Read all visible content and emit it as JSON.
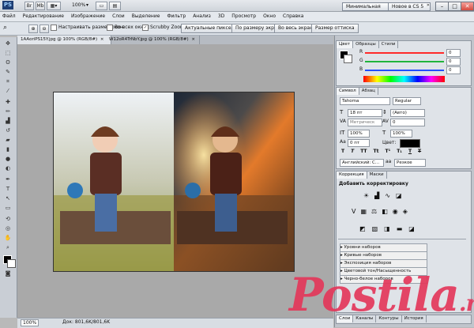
{
  "app": {
    "logo": "PS",
    "zoom": "100%",
    "workspace_label": "Минимальная",
    "new_in_cs5": "Новое в CS 5"
  },
  "menu": [
    "Файл",
    "Редактирование",
    "Изображение",
    "Слои",
    "Выделение",
    "Фильтр",
    "Анализ",
    "3D",
    "Просмотр",
    "Окно",
    "Справка"
  ],
  "options": {
    "resize": "Настраивать размер окон",
    "all_windows": "Во всех окнах",
    "scrubby": "Scrubby Zoom",
    "buttons": [
      "Актуальные пикселы",
      "По размеру экрана",
      "Во весь экран",
      "Размер оттиска"
    ]
  },
  "tabs": [
    {
      "label": "1AAoriPS15Y.jpg @ 100% (RGB/8#)"
    },
    {
      "label": "W12oR4TrNbY.jpg @ 100% (RGB/8#)"
    }
  ],
  "status": {
    "zoom": "100%",
    "doc": "Док: 801,6K/801,6K"
  },
  "color_panel": {
    "tabs": [
      "Цвет",
      "Образцы",
      "Стили"
    ],
    "channels": [
      {
        "label": "R",
        "value": "0",
        "color": "#ff2a2a"
      },
      {
        "label": "G",
        "value": "0",
        "color": "#21b43b"
      },
      {
        "label": "B",
        "value": "0",
        "color": "#214dff"
      }
    ]
  },
  "character_panel": {
    "tabs": [
      "Символ",
      "Абзац"
    ],
    "font": "Tahoma",
    "style": "Regular",
    "size": "18 пт",
    "leading": "(Авто)",
    "kerning": "Метрическ",
    "tracking": "0",
    "vscale": "100%",
    "hscale": "100%",
    "baseline": "0 пт",
    "color_label": "Цвет:",
    "type_buttons": [
      "T",
      "T",
      "TT",
      "Tt",
      "T¹",
      "T₁",
      "T",
      "T"
    ],
    "language": "Английский: С...",
    "aa_label": "аа",
    "aa": "Резкое"
  },
  "adjust_panel": {
    "tabs": [
      "Коррекция",
      "Маски"
    ],
    "title": "Добавить корректировку",
    "presets": [
      "Уровни наборов",
      "Кривые наборов",
      "Экспозиция наборов",
      "Цветовой тон/Насыщенность наборов",
      "Черно-белое наборов"
    ]
  },
  "bottom_tabs": [
    "Слои",
    "Каналы",
    "Контуры",
    "История"
  ],
  "watermark": {
    "main": "Postila",
    "ru": ".ru"
  },
  "colors": {
    "accent": "#e3375a"
  }
}
